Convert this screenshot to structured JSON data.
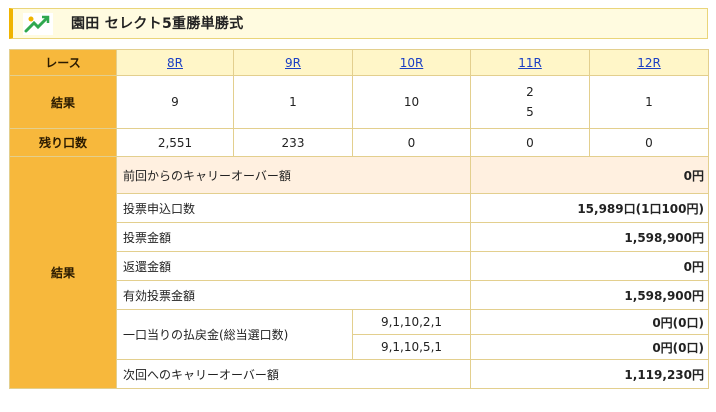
{
  "header": {
    "title": "園田 セレクト5重勝単勝式"
  },
  "race_label": "レース",
  "races": [
    "8R",
    "9R",
    "10R",
    "11R",
    "12R"
  ],
  "result_label": "結果",
  "results": [
    "9",
    "1",
    "10",
    "2",
    "1"
  ],
  "result_extra_11r": "5",
  "remaining_label": "残り口数",
  "remaining": [
    "2,551",
    "233",
    "0",
    "0",
    "0"
  ],
  "payout": {
    "section_label": "結果",
    "carryover_prev_label": "前回からのキャリーオーバー額",
    "carryover_prev_value": "0円",
    "tickets_label": "投票申込口数",
    "tickets_value": "15,989口(1口100円)",
    "amount_label": "投票金額",
    "amount_value": "1,598,900円",
    "refund_label": "返還金額",
    "refund_value": "0円",
    "valid_label": "有効投票金額",
    "valid_value": "1,598,900円",
    "per_unit_label": "一口当りの払戻金(総当選口数)",
    "combos": [
      "9,1,10,2,1",
      "9,1,10,5,1"
    ],
    "combo_values": [
      "0円(0口)",
      "0円(0口)"
    ],
    "carryover_next_label": "次回へのキャリーオーバー額",
    "carryover_next_value": "1,119,230円"
  }
}
